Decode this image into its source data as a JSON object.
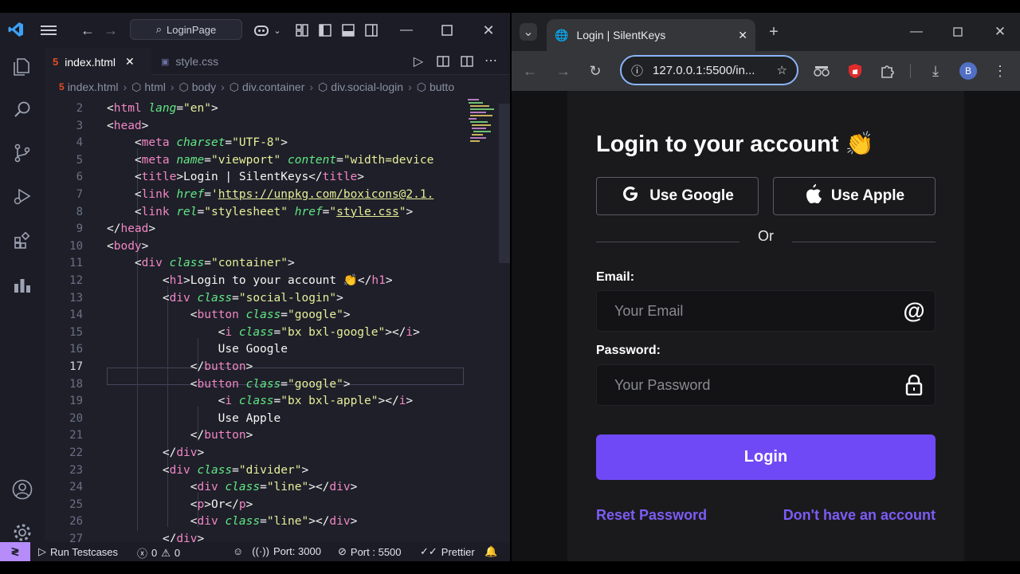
{
  "vscode": {
    "search_text": "LoginPage",
    "tabs": [
      {
        "label": "index.html",
        "active": true
      },
      {
        "label": "style.css",
        "active": false
      }
    ],
    "breadcrumb": [
      "index.html",
      "html",
      "body",
      "div.container",
      "div.social-login",
      "butto"
    ],
    "current_line": 17,
    "lines": [
      {
        "n": "2",
        "tokens": [
          [
            "p",
            "<"
          ],
          [
            "t",
            "html"
          ],
          [
            "p",
            " "
          ],
          [
            "a",
            "lang"
          ],
          [
            "p",
            "="
          ],
          [
            "s",
            "\"en\""
          ],
          [
            "p",
            ">"
          ]
        ]
      },
      {
        "n": "3",
        "tokens": [
          [
            "p",
            "<"
          ],
          [
            "t",
            "head"
          ],
          [
            "p",
            ">"
          ]
        ]
      },
      {
        "n": "4",
        "tokens": [
          [
            "p",
            "    <"
          ],
          [
            "t",
            "meta"
          ],
          [
            "p",
            " "
          ],
          [
            "a",
            "charset"
          ],
          [
            "p",
            "="
          ],
          [
            "s",
            "\"UTF-8\""
          ],
          [
            "p",
            ">"
          ]
        ]
      },
      {
        "n": "5",
        "tokens": [
          [
            "p",
            "    <"
          ],
          [
            "t",
            "meta"
          ],
          [
            "p",
            " "
          ],
          [
            "a",
            "name"
          ],
          [
            "p",
            "="
          ],
          [
            "s",
            "\"viewport\""
          ],
          [
            "p",
            " "
          ],
          [
            "a",
            "content"
          ],
          [
            "p",
            "="
          ],
          [
            "s",
            "\"width=device"
          ]
        ]
      },
      {
        "n": "6",
        "tokens": [
          [
            "p",
            "    <"
          ],
          [
            "t",
            "title"
          ],
          [
            "p",
            ">Login | SilentKeys</"
          ],
          [
            "t",
            "title"
          ],
          [
            "p",
            ">"
          ]
        ]
      },
      {
        "n": "7",
        "tokens": [
          [
            "p",
            "    <"
          ],
          [
            "t",
            "link"
          ],
          [
            "p",
            " "
          ],
          [
            "a",
            "href"
          ],
          [
            "p",
            "="
          ],
          [
            "s",
            "'"
          ],
          [
            "u",
            "https://unpkg.com/boxicons@2.1."
          ]
        ]
      },
      {
        "n": "8",
        "tokens": [
          [
            "p",
            "    <"
          ],
          [
            "t",
            "link"
          ],
          [
            "p",
            " "
          ],
          [
            "a",
            "rel"
          ],
          [
            "p",
            "="
          ],
          [
            "s",
            "\"stylesheet\""
          ],
          [
            "p",
            " "
          ],
          [
            "a",
            "href"
          ],
          [
            "p",
            "="
          ],
          [
            "s",
            "\""
          ],
          [
            "u",
            "style.css"
          ],
          [
            "s",
            "\""
          ],
          [
            "p",
            ">"
          ]
        ]
      },
      {
        "n": "9",
        "tokens": [
          [
            "p",
            "</"
          ],
          [
            "t",
            "head"
          ],
          [
            "p",
            ">"
          ]
        ]
      },
      {
        "n": "10",
        "tokens": [
          [
            "p",
            "<"
          ],
          [
            "t",
            "body"
          ],
          [
            "p",
            ">"
          ]
        ]
      },
      {
        "n": "11",
        "tokens": [
          [
            "p",
            "    <"
          ],
          [
            "t",
            "div"
          ],
          [
            "p",
            " "
          ],
          [
            "a",
            "class"
          ],
          [
            "p",
            "="
          ],
          [
            "s",
            "\"container\""
          ],
          [
            "p",
            ">"
          ]
        ]
      },
      {
        "n": "12",
        "tokens": [
          [
            "p",
            "        <"
          ],
          [
            "t",
            "h1"
          ],
          [
            "p",
            ">Login to your account 👏</"
          ],
          [
            "t",
            "h1"
          ],
          [
            "p",
            ">"
          ]
        ]
      },
      {
        "n": "13",
        "tokens": [
          [
            "p",
            "        <"
          ],
          [
            "t",
            "div"
          ],
          [
            "p",
            " "
          ],
          [
            "a",
            "class"
          ],
          [
            "p",
            "="
          ],
          [
            "s",
            "\"social-login\""
          ],
          [
            "p",
            ">"
          ]
        ]
      },
      {
        "n": "14",
        "tokens": [
          [
            "p",
            "            <"
          ],
          [
            "t",
            "button"
          ],
          [
            "p",
            " "
          ],
          [
            "a",
            "class"
          ],
          [
            "p",
            "="
          ],
          [
            "s",
            "\"google\""
          ],
          [
            "p",
            ">"
          ]
        ]
      },
      {
        "n": "15",
        "tokens": [
          [
            "p",
            "                <"
          ],
          [
            "t",
            "i"
          ],
          [
            "p",
            " "
          ],
          [
            "a",
            "class"
          ],
          [
            "p",
            "="
          ],
          [
            "s",
            "\"bx bxl-google\""
          ],
          [
            "p",
            "></"
          ],
          [
            "t",
            "i"
          ],
          [
            "p",
            ">"
          ]
        ]
      },
      {
        "n": "16",
        "tokens": [
          [
            "p",
            "                Use Google"
          ]
        ]
      },
      {
        "n": "17",
        "tokens": [
          [
            "p",
            "            </"
          ],
          [
            "t",
            "button"
          ],
          [
            "p",
            ">"
          ]
        ]
      },
      {
        "n": "18",
        "tokens": [
          [
            "p",
            "            <"
          ],
          [
            "t",
            "button"
          ],
          [
            "p",
            " "
          ],
          [
            "a",
            "class"
          ],
          [
            "p",
            "="
          ],
          [
            "s",
            "\"google\""
          ],
          [
            "p",
            ">"
          ]
        ]
      },
      {
        "n": "19",
        "tokens": [
          [
            "p",
            "                <"
          ],
          [
            "t",
            "i"
          ],
          [
            "p",
            " "
          ],
          [
            "a",
            "class"
          ],
          [
            "p",
            "="
          ],
          [
            "s",
            "\"bx bxl-apple\""
          ],
          [
            "p",
            "></"
          ],
          [
            "t",
            "i"
          ],
          [
            "p",
            ">"
          ]
        ]
      },
      {
        "n": "20",
        "tokens": [
          [
            "p",
            "                Use Apple"
          ]
        ]
      },
      {
        "n": "21",
        "tokens": [
          [
            "p",
            "            </"
          ],
          [
            "t",
            "button"
          ],
          [
            "p",
            ">"
          ]
        ]
      },
      {
        "n": "22",
        "tokens": [
          [
            "p",
            "        </"
          ],
          [
            "t",
            "div"
          ],
          [
            "p",
            ">"
          ]
        ]
      },
      {
        "n": "23",
        "tokens": [
          [
            "p",
            "        <"
          ],
          [
            "t",
            "div"
          ],
          [
            "p",
            " "
          ],
          [
            "a",
            "class"
          ],
          [
            "p",
            "="
          ],
          [
            "s",
            "\"divider\""
          ],
          [
            "p",
            ">"
          ]
        ]
      },
      {
        "n": "24",
        "tokens": [
          [
            "p",
            "            <"
          ],
          [
            "t",
            "div"
          ],
          [
            "p",
            " "
          ],
          [
            "a",
            "class"
          ],
          [
            "p",
            "="
          ],
          [
            "s",
            "\"line\""
          ],
          [
            "p",
            "></"
          ],
          [
            "t",
            "div"
          ],
          [
            "p",
            ">"
          ]
        ]
      },
      {
        "n": "25",
        "tokens": [
          [
            "p",
            "            <"
          ],
          [
            "t",
            "p"
          ],
          [
            "p",
            ">Or</"
          ],
          [
            "t",
            "p"
          ],
          [
            "p",
            ">"
          ]
        ]
      },
      {
        "n": "26",
        "tokens": [
          [
            "p",
            "            <"
          ],
          [
            "t",
            "div"
          ],
          [
            "p",
            " "
          ],
          [
            "a",
            "class"
          ],
          [
            "p",
            "="
          ],
          [
            "s",
            "\"line\""
          ],
          [
            "p",
            "></"
          ],
          [
            "t",
            "div"
          ],
          [
            "p",
            ">"
          ]
        ]
      },
      {
        "n": "27",
        "tokens": [
          [
            "p",
            "        </"
          ],
          [
            "t",
            "div"
          ],
          [
            "p",
            ">"
          ]
        ]
      }
    ],
    "status": {
      "run": "Run Testcases",
      "errors": "0",
      "warnings": "0",
      "port1": "Port: 3000",
      "port2": "Port : 5500",
      "prettier": "Prettier"
    }
  },
  "chrome": {
    "tab_title": "Login | SilentKeys",
    "url": "127.0.0.1:5500/in...",
    "profile_initial": "B"
  },
  "page": {
    "heading": "Login to your account 👏",
    "google_btn": "Use Google",
    "apple_btn": "Use Apple",
    "divider": "Or",
    "email_label": "Email:",
    "email_placeholder": "Your Email",
    "password_label": "Password:",
    "password_placeholder": "Your Password",
    "login_btn": "Login",
    "reset_link": "Reset Password",
    "signup_link": "Don't have an account"
  },
  "colors": {
    "accent": "#7049f6",
    "link": "#7c5cf5",
    "remote": "#b58cf9"
  }
}
